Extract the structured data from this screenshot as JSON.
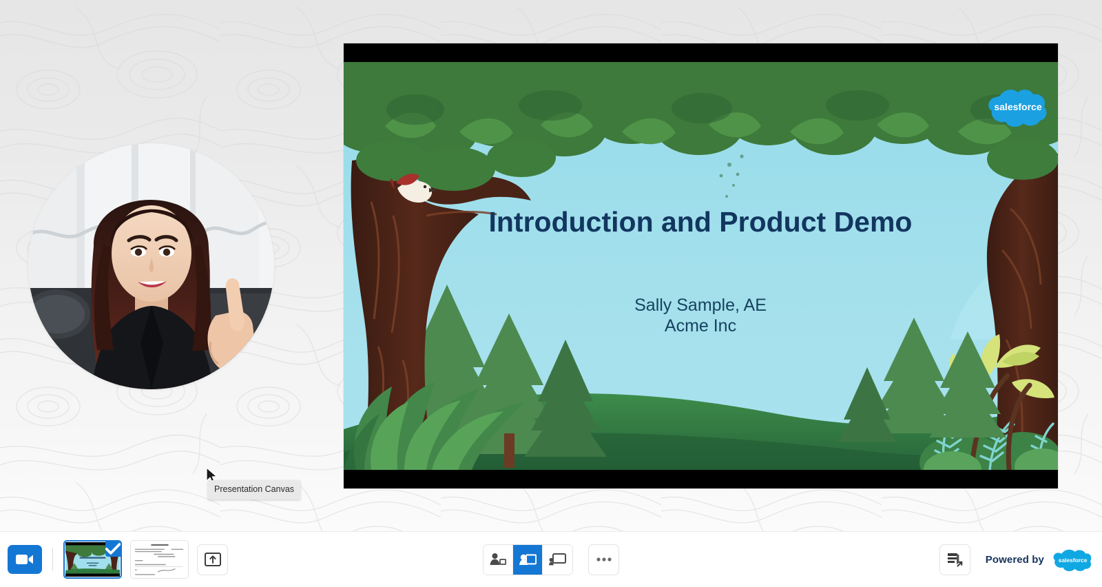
{
  "app": {
    "name": "Presentation Canvas",
    "accent_color": "#1477d4",
    "stage_bg": "#eeeeee",
    "toolbar_bg": "#ffffff"
  },
  "tooltip": {
    "text": "Presentation Canvas",
    "visible": true
  },
  "presenter": {
    "name": "presenter-video",
    "shape": "circle",
    "muted_label": ""
  },
  "slide": {
    "title": "Introduction and Product Demo",
    "presenter_name": "Sally Sample, AE",
    "company": "Acme Inc",
    "brand_logo": "salesforce",
    "brand_logo_text": "salesforce",
    "title_color": "#12365f",
    "subtitle_color": "#16425f",
    "sky_color": "#9fddea",
    "canopy_color": "#3f7a3a",
    "grass_color": "#2f7a3e",
    "trunk_color": "#4a2418",
    "letterbox_color": "#000000"
  },
  "toolbar": {
    "camera_button": {
      "label": "",
      "icon": "video-camera-icon",
      "active": true
    },
    "thumbnails": [
      {
        "index": "1",
        "selected": true,
        "kind": "jungle-title-slide",
        "badge": "checkmark-icon"
      },
      {
        "index": "2",
        "selected": false,
        "kind": "document-slide",
        "badge": ""
      }
    ],
    "upload_button": {
      "label": "",
      "icon": "upload-screen-icon"
    },
    "layout_buttons": [
      {
        "name": "layout-person-small",
        "icon": "person-with-small-screen-icon",
        "active": false
      },
      {
        "name": "layout-person-medium",
        "icon": "person-with-screen-icon",
        "active": true
      },
      {
        "name": "layout-person-large",
        "icon": "screen-with-person-icon",
        "active": false
      }
    ],
    "more_button": {
      "label": "",
      "icon": "ellipsis-icon"
    },
    "notes_button": {
      "label": "",
      "icon": "notes-share-icon"
    },
    "powered_by": {
      "text": "Powered by",
      "brand": "salesforce"
    }
  }
}
